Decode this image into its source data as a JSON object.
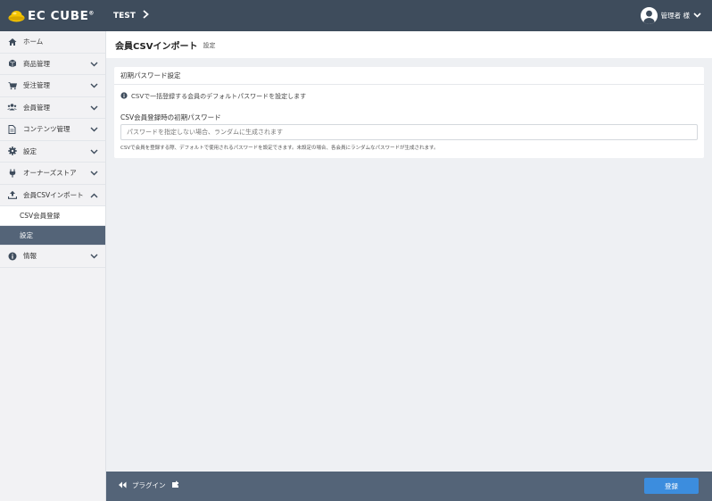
{
  "header": {
    "logo_text": "EC CUBE",
    "logo_reg": "®",
    "shop_name": "TEST",
    "user_name": "管理者 様"
  },
  "sidebar": {
    "items": [
      {
        "label": "ホーム",
        "icon": "home-icon"
      },
      {
        "label": "商品管理",
        "icon": "box-icon"
      },
      {
        "label": "受注管理",
        "icon": "cart-icon"
      },
      {
        "label": "会員管理",
        "icon": "users-icon"
      },
      {
        "label": "コンテンツ管理",
        "icon": "file-icon"
      },
      {
        "label": "設定",
        "icon": "gear-icon"
      },
      {
        "label": "オーナーズストア",
        "icon": "plug-icon"
      },
      {
        "label": "会員CSVインポート",
        "icon": "upload-icon"
      },
      {
        "label": "情報",
        "icon": "info-icon"
      }
    ],
    "subitems": [
      {
        "label": "CSV会員登録"
      },
      {
        "label": "設定"
      }
    ]
  },
  "main": {
    "title": "会員CSVインポート",
    "subtitle": "設定",
    "card_title": "初期パスワード設定",
    "notice": "CSVで一括登録する会員のデフォルトパスワードを設定します",
    "field_label": "CSV会員登録時の初期パスワード",
    "field_placeholder": "パスワードを指定しない場合、ランダムに生成されます",
    "field_value": "",
    "help": "CSVで会員を登録する際、デフォルトで使用されるパスワードを設定できます。未設定の場合、各会員にランダムなパスワードが生成されます。"
  },
  "footer": {
    "back_label": "プラグイン",
    "save_label": "登録"
  },
  "colors": {
    "header_bg": "#3e4c5c",
    "footer_bg": "#546478",
    "accent": "#3c8dde",
    "active_nav": "#546478",
    "logo_yellow": "#f5c400"
  }
}
